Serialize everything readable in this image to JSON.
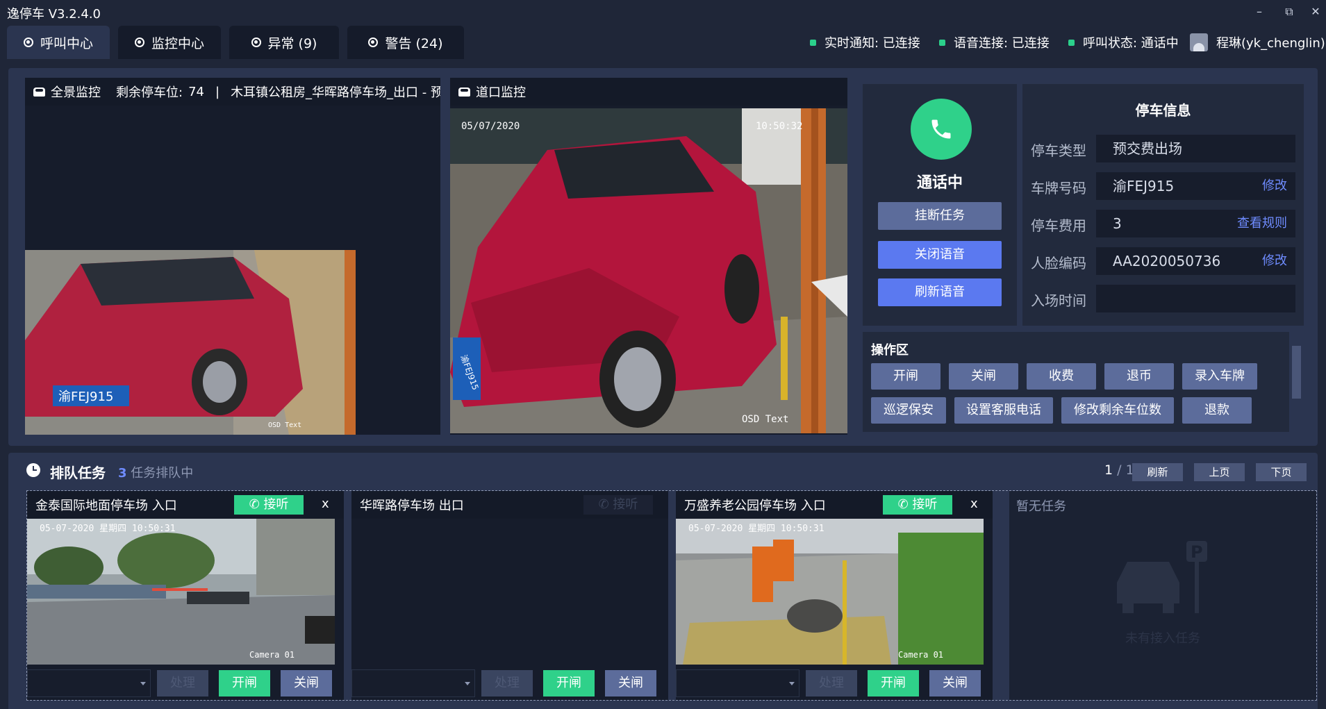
{
  "app": {
    "title": "逸停车 V3.2.4.0"
  },
  "window_controls": {
    "minimize": "–",
    "restore": "⧉",
    "close": "✕"
  },
  "tabs": [
    {
      "label": "呼叫中心",
      "active": true
    },
    {
      "label": "监控中心",
      "active": false
    },
    {
      "label": "异常 (9)",
      "active": false
    },
    {
      "label": "警告 (24)",
      "active": false
    }
  ],
  "status": {
    "realtime": "实时通知: 已连接",
    "voice": "语音连接: 已连接",
    "call": "呼叫状态: 通话中",
    "user": "程琳(yk_chenglin)",
    "indicator_color": "#2bd08b"
  },
  "panorama": {
    "title": "全景监控",
    "spaces_label": "剩余停车位:",
    "spaces_value": "74",
    "separator": "|",
    "location": "木耳镇公租房_华晖路停车场_出口 - 预"
  },
  "gate": {
    "title": "道口监控",
    "date_overlay": "05/07/2020",
    "time_overlay": "10:50:32",
    "osd_overlay": "OSD Text",
    "plate_overlay": "渝FEJ915"
  },
  "panorama_snapshot": {
    "plate_overlay": "渝FEJ915",
    "osd_overlay": "OSD Text"
  },
  "call": {
    "status": "通话中",
    "hangup": "挂断任务",
    "close_voice": "关闭语音",
    "refresh_voice": "刷新语音"
  },
  "parking_info": {
    "title": "停车信息",
    "rows": [
      {
        "label": "停车类型",
        "value": "预交费出场",
        "link": ""
      },
      {
        "label": "车牌号码",
        "value": "渝FEJ915",
        "link": "修改"
      },
      {
        "label": "停车费用",
        "value": "3",
        "link": "查看规则"
      },
      {
        "label": "人脸编码",
        "value": "AA2020050736",
        "link": "修改"
      },
      {
        "label": "入场时间",
        "value": "",
        "link": ""
      }
    ]
  },
  "ops": {
    "title": "操作区",
    "row1": [
      "开闸",
      "关闸",
      "收费",
      "退币",
      "录入车牌"
    ],
    "row2": [
      "巡逻保安",
      "设置客服电话",
      "修改剩余车位数",
      "退款"
    ]
  },
  "queue": {
    "title": "排队任务",
    "count": "3",
    "count_suffix": "任务排队中",
    "page_current": "1",
    "page_total": "/ 1",
    "refresh": "刷新",
    "prev": "上页",
    "next": "下页",
    "cards": [
      {
        "title": "金泰国际地面停车场 入口",
        "answer": "接听",
        "close": "x",
        "has_image": true,
        "overlay": "05-07-2020 星期四 10:50:31",
        "camera": "Camera 01",
        "dismiss": "处理",
        "open": "开闸",
        "shut": "关闸"
      },
      {
        "title": "华晖路停车场 出口",
        "answer": "接听",
        "close": "",
        "has_image": false,
        "overlay": "",
        "camera": "",
        "dismiss": "处理",
        "open": "开闸",
        "shut": "关闸"
      },
      {
        "title": "万盛养老公园停车场 入口",
        "answer": "接听",
        "close": "x",
        "has_image": true,
        "overlay": "05-07-2020 星期四 10:50:31",
        "camera": "Camera 01",
        "dismiss": "处理",
        "open": "开闸",
        "shut": "关闸"
      }
    ],
    "empty": {
      "title": "暂无任务",
      "text": "未有接入任务"
    }
  }
}
